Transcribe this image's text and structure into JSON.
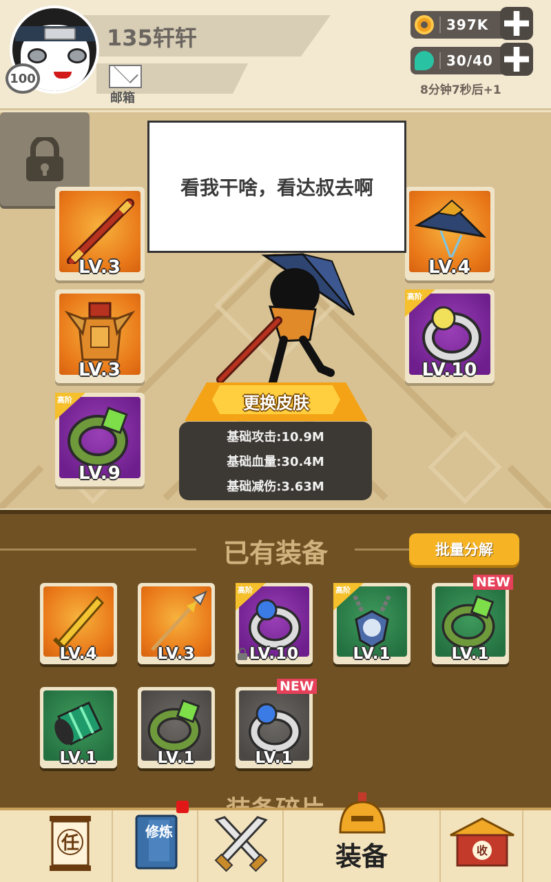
{
  "player": {
    "name": "135轩轩",
    "level": "100",
    "mail_label": "邮箱"
  },
  "resources": {
    "gold": "397K",
    "stamina": "30/40",
    "stamina_timer": "8分钟7秒后+1"
  },
  "hero_panel": {
    "speech": "看我干啥，看达叔去啊",
    "skin_button": "更换皮肤",
    "stats": [
      "基础攻击:10.9M",
      "基础血量:30.4M",
      "基础减伤:3.63M"
    ],
    "left_slots": [
      {
        "item": "staff",
        "level": "LV.3",
        "rarity": "orange",
        "advanced": false
      },
      {
        "item": "armor",
        "level": "LV.3",
        "rarity": "orange",
        "advanced": false
      },
      {
        "item": "jade-ring",
        "level": "LV.9",
        "rarity": "purple",
        "advanced": true
      }
    ],
    "right_slots": [
      {
        "item": "bamboo-hat",
        "level": "LV.4",
        "rarity": "orange",
        "advanced": false
      },
      {
        "item": "silver-ring",
        "level": "LV.10",
        "rarity": "purple",
        "advanced": true
      },
      {
        "item": "locked",
        "level": "",
        "rarity": "gray",
        "advanced": false
      }
    ],
    "advanced_tag": "高阶"
  },
  "inventory": {
    "title": "已有装备",
    "bulk_button": "批量分解",
    "new_tag": "NEW",
    "items": [
      {
        "item": "golden-sword",
        "level": "LV.4",
        "rarity": "orange",
        "advanced": false,
        "is_new": false
      },
      {
        "item": "spear",
        "level": "LV.3",
        "rarity": "orange",
        "advanced": false,
        "is_new": false
      },
      {
        "item": "silver-ring",
        "level": "LV.10",
        "rarity": "purple",
        "advanced": true,
        "is_new": false,
        "locked": true
      },
      {
        "item": "amulet",
        "level": "LV.1",
        "rarity": "green",
        "advanced": true,
        "is_new": false
      },
      {
        "item": "jade-ring",
        "level": "LV.1",
        "rarity": "green",
        "advanced": false,
        "is_new": true
      },
      {
        "item": "bracer",
        "level": "LV.1",
        "rarity": "green",
        "advanced": false,
        "is_new": false
      },
      {
        "item": "jade-ring",
        "level": "LV.1",
        "rarity": "gray",
        "advanced": false,
        "is_new": false
      },
      {
        "item": "silver-ring",
        "level": "LV.1",
        "rarity": "gray",
        "advanced": false,
        "is_new": true
      }
    ],
    "shards_title": "装备碎片"
  },
  "nav": {
    "quest_char": "任",
    "cultivate_text": "修炼",
    "equip_label": "装备",
    "shop_char": "收"
  }
}
